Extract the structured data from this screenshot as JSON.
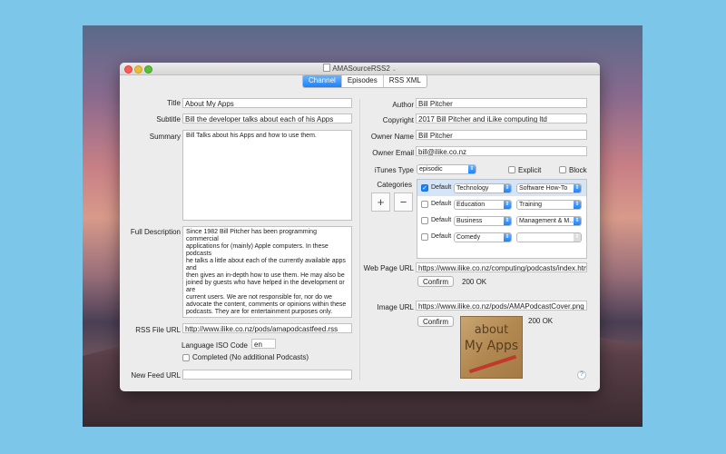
{
  "window": {
    "title": "AMASourceRSS2"
  },
  "tabs": [
    {
      "label": "Channel",
      "active": true
    },
    {
      "label": "Episodes",
      "active": false
    },
    {
      "label": "RSS XML",
      "active": false
    }
  ],
  "left": {
    "title": {
      "label": "Title",
      "value": "About My Apps"
    },
    "subtitle": {
      "label": "Subtitle",
      "value": "Bill the developer talks about each of his Apps"
    },
    "summary": {
      "label": "Summary",
      "value": "Bill Talks about his Apps and how to use them."
    },
    "full_description": {
      "label": "Full Description",
      "value": "Since 1982 Bill Pitcher has been programming commercial\napplications for (mainly) Apple computers. In these podcasts\nhe talks a little about each of the currently available apps and\nthen gives an in-depth how to use them. He may also be\njoined by guests who have helped in the development or are\ncurrent users. We are not responsible for, nor do we\nadvocate the content, comments or opinions within these\npodcasts. They are for entertainment purposes only."
    },
    "rss_file_url": {
      "label": "RSS File URL",
      "value": "http://www.ilike.co.nz/pods/amapodcastfeed.rss"
    },
    "language": {
      "label": "Language ISO Code",
      "value": "en"
    },
    "completed": {
      "label": "Completed (No additional Podcasts)",
      "checked": false
    },
    "new_feed_url": {
      "label": "New Feed URL",
      "value": ""
    }
  },
  "right": {
    "author": {
      "label": "Author",
      "value": "Bill Pitcher"
    },
    "copyright": {
      "label": "Copyright",
      "value": "2017 Bill Pitcher and iLike computing ltd"
    },
    "owner_name": {
      "label": "Owner Name",
      "value": "Bill Pitcher"
    },
    "owner_email": {
      "label": "Owner Email",
      "value": "bill@ilike.co.nz"
    },
    "itunes_type": {
      "label": "iTunes Type",
      "value": "episodic"
    },
    "explicit": {
      "label": "Explicit",
      "checked": false
    },
    "block": {
      "label": "Block",
      "checked": false
    },
    "categories": {
      "label": "Categories",
      "add_label": "+",
      "remove_label": "−",
      "rows": [
        {
          "default_label": "Default",
          "checked": true,
          "category": "Technology",
          "subcategory": "Software How-To"
        },
        {
          "default_label": "Default",
          "checked": false,
          "category": "Education",
          "subcategory": "Training"
        },
        {
          "default_label": "Default",
          "checked": false,
          "category": "Business",
          "subcategory": "Management & M..."
        },
        {
          "default_label": "Default",
          "checked": false,
          "category": "Comedy",
          "subcategory": ""
        }
      ]
    },
    "web_page": {
      "label": "Web Page URL",
      "value": "https://www.ilike.co.nz/computing/podcasts/index.html",
      "confirm_label": "Confirm",
      "status": "200 OK"
    },
    "image": {
      "label": "Image URL",
      "value": "https://www.ilike.co.nz/pods/AMAPodcastCover.png",
      "confirm_label": "Confirm",
      "status": "200 OK",
      "cover_line1": "about",
      "cover_line2": "My Apps"
    }
  },
  "help_label": "?",
  "colors": {
    "accent": "#1a82fb",
    "window_bg": "#ececec"
  },
  "icons": {
    "close": "close-icon",
    "minimize": "minimize-icon",
    "zoom": "zoom-icon",
    "help": "help-icon",
    "popup_arrows": "chevron-updown-icon"
  }
}
